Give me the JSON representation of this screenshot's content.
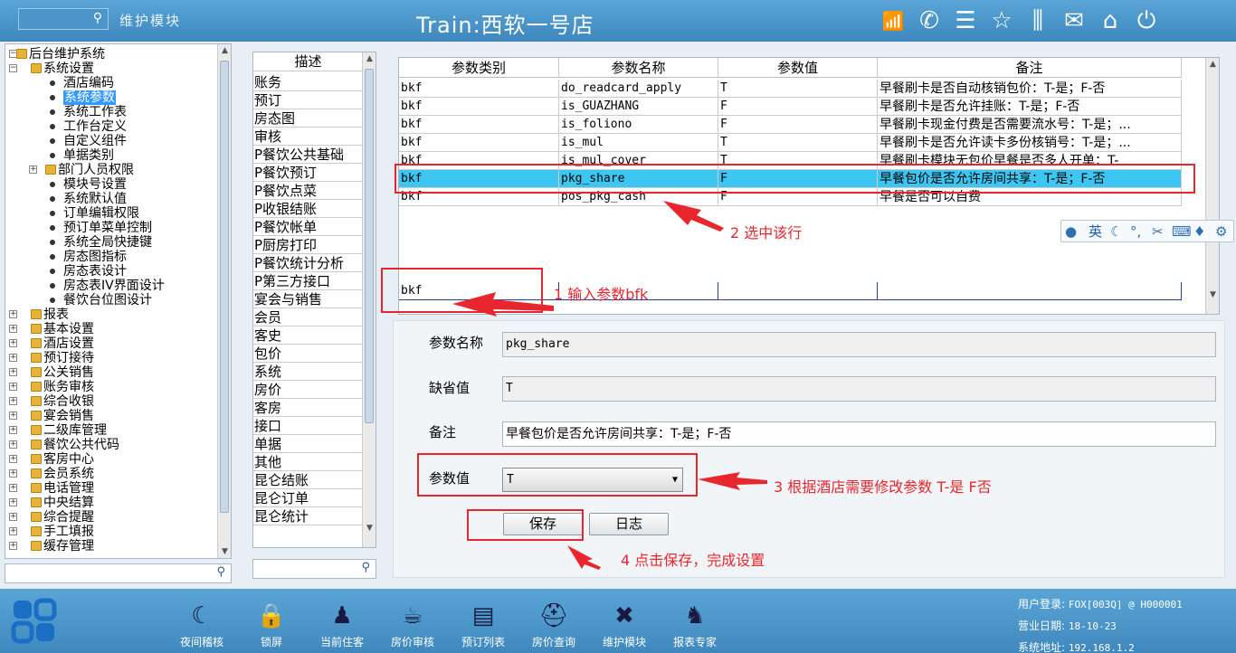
{
  "header": {
    "module_label": "维护模块",
    "title": "Train:西软一号店",
    "icons": [
      "signal-icon",
      "phone-icon",
      "menu-icon",
      "star-icon",
      "columns-icon",
      "mail-icon",
      "home-icon",
      "power-icon"
    ]
  },
  "tree": {
    "items": [
      {
        "label": "后台维护系统",
        "level": 0,
        "type": "folder",
        "expander": "−"
      },
      {
        "label": "系统设置",
        "level": 1,
        "type": "folder",
        "expander": "−"
      },
      {
        "label": "酒店编码",
        "level": 2,
        "type": "leaf"
      },
      {
        "label": "系统参数",
        "level": 2,
        "type": "leaf",
        "selected": true
      },
      {
        "label": "系统工作表",
        "level": 2,
        "type": "leaf"
      },
      {
        "label": "工作台定义",
        "level": 2,
        "type": "leaf"
      },
      {
        "label": "自定义组件",
        "level": 2,
        "type": "leaf"
      },
      {
        "label": "单据类别",
        "level": 2,
        "type": "leaf"
      },
      {
        "label": "部门人员权限",
        "level": 2,
        "type": "folder",
        "expander": "+"
      },
      {
        "label": "模块号设置",
        "level": 2,
        "type": "leaf"
      },
      {
        "label": "系统默认值",
        "level": 2,
        "type": "leaf"
      },
      {
        "label": "订单编辑权限",
        "level": 2,
        "type": "leaf"
      },
      {
        "label": "预订单菜单控制",
        "level": 2,
        "type": "leaf"
      },
      {
        "label": "系统全局快捷键",
        "level": 2,
        "type": "leaf"
      },
      {
        "label": "房态图指标",
        "level": 2,
        "type": "leaf"
      },
      {
        "label": "房态表设计",
        "level": 2,
        "type": "leaf"
      },
      {
        "label": "房态表IV界面设计",
        "level": 2,
        "type": "leaf"
      },
      {
        "label": "餐饮台位图设计",
        "level": 2,
        "type": "leaf"
      },
      {
        "label": "报表",
        "level": 1,
        "type": "folder",
        "expander": "+"
      },
      {
        "label": "基本设置",
        "level": 1,
        "type": "folder",
        "expander": "+"
      },
      {
        "label": "酒店设置",
        "level": 1,
        "type": "folder",
        "expander": "+"
      },
      {
        "label": "预订接待",
        "level": 1,
        "type": "folder",
        "expander": "+"
      },
      {
        "label": "公关销售",
        "level": 1,
        "type": "folder",
        "expander": "+"
      },
      {
        "label": "账务审核",
        "level": 1,
        "type": "folder",
        "expander": "+"
      },
      {
        "label": "综合收银",
        "level": 1,
        "type": "folder",
        "expander": "+"
      },
      {
        "label": "宴会销售",
        "level": 1,
        "type": "folder",
        "expander": "+"
      },
      {
        "label": "二级库管理",
        "level": 1,
        "type": "folder",
        "expander": "+"
      },
      {
        "label": "餐饮公共代码",
        "level": 1,
        "type": "folder",
        "expander": "+"
      },
      {
        "label": "客房中心",
        "level": 1,
        "type": "folder",
        "expander": "+"
      },
      {
        "label": "会员系统",
        "level": 1,
        "type": "folder",
        "expander": "+"
      },
      {
        "label": "电话管理",
        "level": 1,
        "type": "folder",
        "expander": "+"
      },
      {
        "label": "中央结算",
        "level": 1,
        "type": "folder",
        "expander": "+"
      },
      {
        "label": "综合提醒",
        "level": 1,
        "type": "folder",
        "expander": "+"
      },
      {
        "label": "手工填报",
        "level": 1,
        "type": "folder",
        "expander": "+"
      },
      {
        "label": "缓存管理",
        "level": 1,
        "type": "folder",
        "expander": "+"
      }
    ]
  },
  "desc_list": {
    "header": "描述",
    "items": [
      "账务",
      "预订",
      "房态图",
      "审核",
      "P餐饮公共基础",
      "P餐饮预订",
      "P餐饮点菜",
      "P收银结账",
      "P餐饮帐单",
      "P厨房打印",
      "P餐饮统计分析",
      "P第三方接口",
      "宴会与销售",
      "会员",
      "客史",
      "包价",
      "系统",
      "房价",
      "客房",
      "接口",
      "单据",
      "其他",
      "昆仑结账",
      "昆仑订单",
      "昆仑统计"
    ]
  },
  "grid": {
    "columns": [
      "参数类别",
      "参数名称",
      "参数值",
      "备注"
    ],
    "rows": [
      [
        "bkf",
        "do_readcard_apply",
        "T",
        "早餐刷卡是否自动核销包价：T-是；F-否"
      ],
      [
        "bkf",
        "is_GUAZHANG",
        "F",
        "早餐刷卡是否允许挂账：T-是；F-否"
      ],
      [
        "bkf",
        "is_foliono",
        "F",
        "早餐刷卡现金付费是否需要流水号：T-是；..."
      ],
      [
        "bkf",
        "is_mul",
        "T",
        "早餐刷卡是否允许读卡多份核销号：T-是；..."
      ],
      [
        "bkf",
        "is_mul_cover",
        "T",
        "早餐刷卡模块无包价早餐是否多人开单：T-"
      ],
      [
        "bkf",
        "pkg_share",
        "F",
        "早餐包价是否允许房间共享：T-是；F-否"
      ],
      [
        "bkf",
        "pos_pkg_cash",
        "F",
        "早餐是否可以自费"
      ]
    ],
    "selected_row": 5,
    "filter_value": "bkf"
  },
  "form": {
    "name_label": "参数名称",
    "name_value": "pkg_share",
    "default_label": "缺省值",
    "default_value": "T",
    "remark_label": "备注",
    "remark_value": "早餐包价是否允许房间共享：T-是；F-否",
    "param_label": "参数值",
    "param_value": "T",
    "save_label": "保存",
    "log_label": "日志"
  },
  "annotations": {
    "step1": "1 输入参数bfk",
    "step2": "2 选中该行",
    "step3": "3 根据酒店需要修改参数  T-是  F否",
    "step4": "4 点击保存，完成设置"
  },
  "ime": {
    "lang": "英"
  },
  "dock": {
    "items": [
      {
        "label": "夜间稽核",
        "icon": "moon-icon",
        "glyph": "☾"
      },
      {
        "label": "锁屏",
        "icon": "lock-icon",
        "glyph": "🔒"
      },
      {
        "label": "当前住客",
        "icon": "guest-icon",
        "glyph": "♟"
      },
      {
        "label": "房价审核",
        "icon": "coffee-icon",
        "glyph": "☕"
      },
      {
        "label": "预订列表",
        "icon": "list-icon",
        "glyph": "▤"
      },
      {
        "label": "房价查询",
        "icon": "hat-icon",
        "glyph": "⛑"
      },
      {
        "label": "维护模块",
        "icon": "tools-icon",
        "glyph": "✖"
      },
      {
        "label": "报表专家",
        "icon": "expert-icon",
        "glyph": "♞"
      }
    ]
  },
  "status": {
    "user_label": "用户登录:",
    "user_value": "FOX[003Q] @ H000001",
    "date_label": "营业日期:",
    "date_value": "18-10-23",
    "addr_label": "系统地址:",
    "addr_value": "192.168.1.2"
  }
}
